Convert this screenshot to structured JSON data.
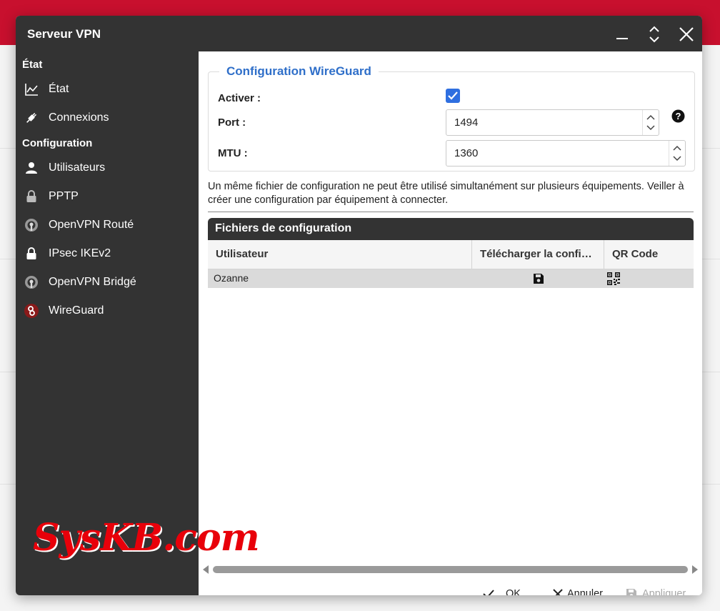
{
  "window": {
    "title": "Serveur VPN"
  },
  "sidebar": {
    "sections": [
      {
        "label": "État"
      },
      {
        "label": "Configuration"
      }
    ],
    "items": [
      {
        "label": "État",
        "icon": "chart-line-icon"
      },
      {
        "label": "Connexions",
        "icon": "plug-icon"
      },
      {
        "label": "Utilisateurs",
        "icon": "user-icon"
      },
      {
        "label": "PPTP",
        "icon": "lock-icon"
      },
      {
        "label": "OpenVPN Routé",
        "icon": "openvpn-icon"
      },
      {
        "label": "IPsec IKEv2",
        "icon": "lock-icon"
      },
      {
        "label": "OpenVPN Bridgé",
        "icon": "openvpn-icon"
      },
      {
        "label": "WireGuard",
        "icon": "wireguard-icon"
      }
    ]
  },
  "config": {
    "legend": "Configuration WireGuard",
    "enable_label": "Activer :",
    "enabled": true,
    "port_label": "Port :",
    "port_value": "1494",
    "mtu_label": "MTU :",
    "mtu_value": "1360",
    "note": "Un même fichier de configuration ne peut être utilisé simultanément sur plusieurs équipements. Veiller à créer une configuration par équipement à connecter."
  },
  "files": {
    "title": "Fichiers de configuration",
    "columns": [
      "Utilisateur",
      "Télécharger la confi…",
      "QR Code"
    ],
    "rows": [
      {
        "user": "Ozanne",
        "download_icon": "save-icon",
        "qr_icon": "qr-code-icon"
      }
    ]
  },
  "footer": {
    "ok_label": "OK",
    "cancel_label": "Annuler",
    "apply_label": "Appliquer"
  },
  "watermark": "SysKB.com",
  "colors": {
    "accent": "#2f6fc9",
    "sidebar_bg": "#333333",
    "brand_bar": "#c8102e",
    "watermark": "#e8000a"
  }
}
